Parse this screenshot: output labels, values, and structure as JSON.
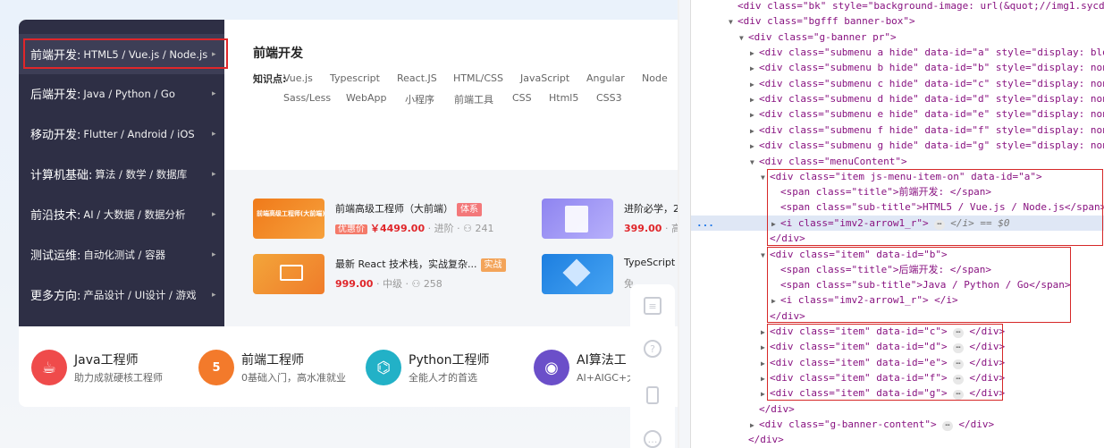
{
  "menu": {
    "items": [
      {
        "title": "前端开发:",
        "sub": "HTML5 / Vue.js / Node.js"
      },
      {
        "title": "后端开发:",
        "sub": "Java / Python / Go"
      },
      {
        "title": "移动开发:",
        "sub": "Flutter / Android / iOS"
      },
      {
        "title": "计算机基础:",
        "sub": "算法 / 数学 / 数据库"
      },
      {
        "title": "前沿技术:",
        "sub": "AI / 大数据 / 数据分析"
      },
      {
        "title": "测试运维:",
        "sub": "自动化测试 / 容器"
      },
      {
        "title": "更多方向:",
        "sub": "产品设计 / UI设计 / 游戏"
      }
    ],
    "arrow": "▸"
  },
  "submenu": {
    "heading": "前端开发",
    "kp_label": "知识点:",
    "tags_row1": [
      "Vue.js",
      "Typescript",
      "React.JS",
      "HTML/CSS",
      "JavaScript",
      "Angular",
      "Node"
    ],
    "tags_row2": [
      "Sass/Less",
      "WebApp",
      "小程序",
      "前端工具",
      "CSS",
      "Html5",
      "CSS3"
    ]
  },
  "courses": [
    {
      "name": "前端高级工程师（大前端）",
      "badge": "体系",
      "youhui": "优惠价",
      "price": "￥4499.00",
      "level": "· 进阶 · ",
      "count": "241",
      "thumb_text": "前端高级工程师(大前端)"
    },
    {
      "name": "进阶必学，2",
      "price": "399.00",
      "level": "· 高"
    },
    {
      "name": "最新 React 技术栈，实战复杂...",
      "badge": "实战",
      "price": "999.00",
      "level": "· 中级 · ",
      "count": "258"
    },
    {
      "name": "TypeScript",
      "level": "免"
    }
  ],
  "cards": [
    {
      "title": "Java工程师",
      "desc": "助力成就硬核工程师",
      "color": "#ef4b4b",
      "icon": "coffee-icon"
    },
    {
      "title": "前端工程师",
      "desc": "0基础入门，高水准就业",
      "color": "#f37a2b",
      "icon": "html5-icon"
    },
    {
      "title": "Python工程师",
      "desc": "全能人才的首选",
      "color": "#22b1c7",
      "icon": "python-icon"
    },
    {
      "title": "AI算法工",
      "desc": "AI+AIGC+大",
      "color": "#6b4fc9",
      "icon": "robot-icon"
    }
  ],
  "devtools": {
    "lines": [
      {
        "indent": 0,
        "tri": "",
        "html": "bk"
      },
      {
        "indent": 0,
        "tri": "▼",
        "html": "bgfff"
      },
      {
        "indent": 1,
        "tri": "▼",
        "html": "g-banner"
      },
      {
        "indent": 2,
        "tri": "▶",
        "html": "submenu_a"
      }
    ],
    "text": {
      "l0": "<div class=\"bk\" style=\"background-image: url(&quot;//img1.sycd",
      "l1": "<div class=\"bgfff banner-box\">",
      "l2": "<div class=\"g-banner pr\">",
      "sub_a": "<div class=\"submenu a hide\" data-id=\"a\" style=\"display: blo",
      "sub_b": "<div class=\"submenu b hide\" data-id=\"b\" style=\"display: non",
      "sub_c": "<div class=\"submenu c hide\" data-id=\"c\" style=\"display: non",
      "sub_d": "<div class=\"submenu d hide\" data-id=\"d\" style=\"display: non",
      "sub_e": "<div class=\"submenu e hide\" data-id=\"e\" style=\"display: non",
      "sub_f": "<div class=\"submenu f hide\" data-id=\"f\" style=\"display: non",
      "sub_g": "<div class=\"submenu g hide\" data-id=\"g\" style=\"display: non",
      "menuContent": "<div class=\"menuContent\">",
      "item_a": "<div class=\"item js-menu-item-on\" data-id=\"a\">",
      "item_a_title": "<span class=\"title\">前端开发: </span>",
      "item_a_sub": "<span class=\"sub-title\">HTML5 / Vue.js / Node.js</span>",
      "item_a_i": "<i class=\"imv2-arrow1_r\">",
      "item_a_i_end": "</i> == $0",
      "close_div": "</div>",
      "item_b": "<div class=\"item\" data-id=\"b\">",
      "item_b_title": "<span class=\"title\">后端开发: </span>",
      "item_b_sub": "<span class=\"sub-title\">Java / Python / Go</span>",
      "item_b_i": "<i class=\"imv2-arrow1_r\"> </i>",
      "item_c": "<div class=\"item\" data-id=\"c\">",
      "item_d": "<div class=\"item\" data-id=\"d\">",
      "item_e": "<div class=\"item\" data-id=\"e\">",
      "item_f": "<div class=\"item\" data-id=\"f\">",
      "item_g": "<div class=\"item\" data-id=\"g\">",
      "banner_content": "<div class=\"g-banner-content\">",
      "close_div_end": "</div>",
      "ellipsis": "⋯",
      "gutter_dots": "..."
    }
  },
  "side_tools": [
    "chat-icon",
    "help-icon",
    "phone-icon",
    "feedback-icon"
  ]
}
